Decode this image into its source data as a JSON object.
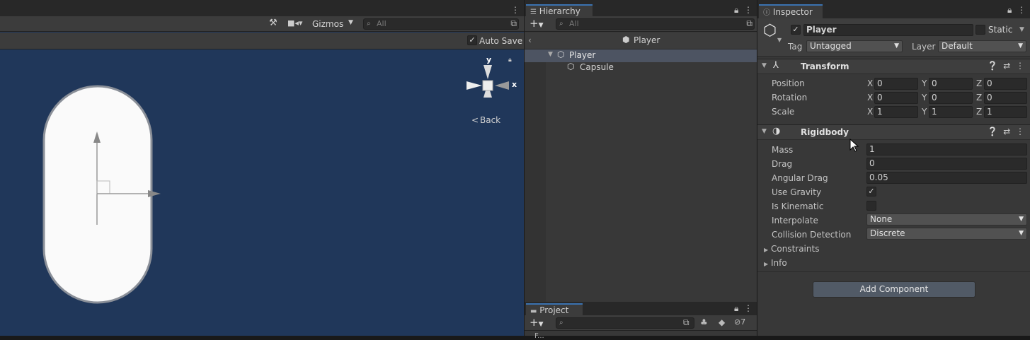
{
  "scene": {
    "toolbar": {
      "gizmos_label": "Gizmos",
      "search_placeholder": "All"
    },
    "autosave_label": "Auto Save",
    "autosave_checked": true,
    "orientation": {
      "y_label": "y",
      "x_label": "x",
      "view_label": "Back",
      "back_glyph": "<"
    }
  },
  "hierarchy": {
    "tab_label": "Hierarchy",
    "add_label": "+",
    "search_placeholder": "All",
    "breadcrumb": "Player",
    "items": [
      {
        "label": "Player",
        "selected": true
      },
      {
        "label": "Capsule",
        "selected": false
      }
    ]
  },
  "project": {
    "tab_label": "Project",
    "add_label": "+",
    "hidden_count": "7",
    "partial_text": "F..."
  },
  "inspector": {
    "tab_label": "Inspector",
    "object_name": "Player",
    "static_label": "Static",
    "tag_label": "Tag",
    "tag_value": "Untagged",
    "layer_label": "Layer",
    "layer_value": "Default",
    "transform": {
      "title": "Transform",
      "rows": [
        {
          "label": "Position",
          "x": "0",
          "y": "0",
          "z": "0"
        },
        {
          "label": "Rotation",
          "x": "0",
          "y": "0",
          "z": "0"
        },
        {
          "label": "Scale",
          "x": "1",
          "y": "1",
          "z": "1"
        }
      ],
      "axes": [
        "X",
        "Y",
        "Z"
      ]
    },
    "rigidbody": {
      "title": "Rigidbody",
      "mass_label": "Mass",
      "mass_value": "1",
      "drag_label": "Drag",
      "drag_value": "0",
      "angular_drag_label": "Angular Drag",
      "angular_drag_value": "0.05",
      "use_gravity_label": "Use Gravity",
      "use_gravity": true,
      "is_kinematic_label": "Is Kinematic",
      "is_kinematic": false,
      "interpolate_label": "Interpolate",
      "interpolate_value": "None",
      "collision_label": "Collision Detection",
      "collision_value": "Discrete",
      "constraints_label": "Constraints",
      "info_label": "Info"
    },
    "add_component_label": "Add Component"
  },
  "colors": {
    "scene_bg": "#20375a",
    "accent": "#3a72b0",
    "selected_row": "#4d5462"
  }
}
